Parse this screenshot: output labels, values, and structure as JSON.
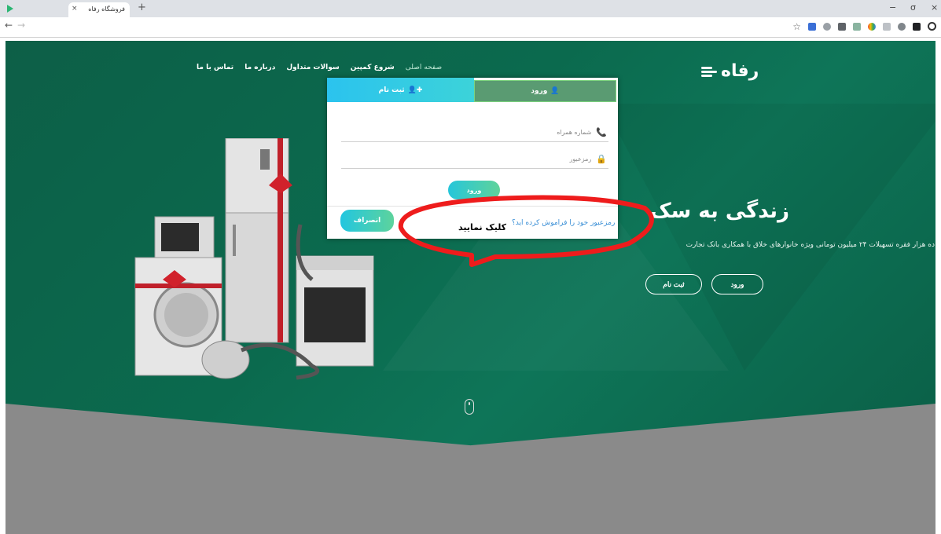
{
  "browser": {
    "tab_title": "فروشگاه رفاه",
    "tab_close": "×",
    "new_tab": "+",
    "back": "←",
    "forward": "→",
    "minimize": "−",
    "maximize": "σ",
    "close": "×"
  },
  "header": {
    "logo_text": "رفاه",
    "nav": [
      {
        "label": "صفحه اصلی",
        "active": true
      },
      {
        "label": "شروع کمپین"
      },
      {
        "label": "سوالات متداول"
      },
      {
        "label": "درباره ما"
      },
      {
        "label": "تماس با ما"
      }
    ]
  },
  "hero": {
    "headline": "زندگی به سک",
    "subline": "ده هزار فقره تسهیلات ۲۴ میلیون تومانی ویژه خانوارهای خلاق با همکاری بانک تجارت",
    "login_button": "ورود",
    "register_button": "ثبت نام"
  },
  "modal": {
    "tab_login": "ورود",
    "tab_register": "ثبت نام",
    "phone_placeholder": "شماره همراه",
    "password_placeholder": "رمزعبور",
    "submit": "ورود",
    "cancel": "انصراف",
    "forgot_password": "رمزعبور خود را فراموش کرده اید؟"
  },
  "annotation": {
    "text": "کلیک نمایید",
    "color": "#ee1c1c"
  },
  "colors": {
    "hero_green": "#0b6a4e",
    "accent_cyan": "#26c6da",
    "accent_green": "#5fd39a",
    "tab_login_bg": "#5a9b72"
  }
}
